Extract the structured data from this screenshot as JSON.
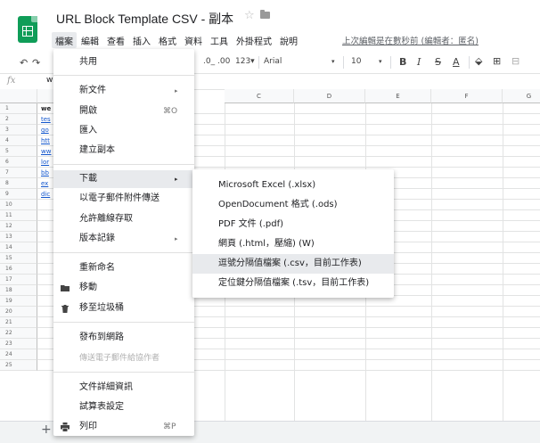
{
  "header": {
    "title": "URL Block Template CSV - 副本",
    "last_edit": "上次編輯是在數秒前 (編輯者：匿名)"
  },
  "menubar": [
    "檔案",
    "編輯",
    "查看",
    "插入",
    "格式",
    "資料",
    "工具",
    "外掛程式",
    "說明"
  ],
  "toolbar": {
    "decimal_decrease": ".0_",
    "decimal_increase": ".00",
    "format": "123▾",
    "font": "Arial",
    "font_dropdown": "▾",
    "font_size": "10",
    "size_dropdown": "▾",
    "bold": "B",
    "italic": "I",
    "strike": "S",
    "text_color": "A"
  },
  "formula_bar": {
    "fx": "fx",
    "cell_ref": "w"
  },
  "columns": [
    "C",
    "D",
    "E",
    "F",
    "G"
  ],
  "rows": [
    "1",
    "2",
    "3",
    "4",
    "5",
    "6",
    "7",
    "8",
    "9",
    "10",
    "11",
    "12",
    "13",
    "14",
    "15",
    "16",
    "17",
    "18",
    "19",
    "20",
    "21",
    "22",
    "23",
    "24",
    "25"
  ],
  "column_a_visible": [
    "we",
    "tes",
    "go",
    "htt",
    "ww",
    "lor",
    "bb",
    "ex",
    "dic"
  ],
  "file_menu": {
    "share": "共用",
    "new": "新文件",
    "open": "開啟",
    "open_shortcut": "⌘O",
    "import": "匯入",
    "make_copy": "建立副本",
    "download": "下載",
    "email_attachment": "以電子郵件附件傳送",
    "offline": "允許離線存取",
    "version_history": "版本記錄",
    "rename": "重新命名",
    "move": "移動",
    "trash": "移至垃圾桶",
    "publish": "發布到網路",
    "email_collaborators": "傳送電子郵件給協作者",
    "doc_details": "文件詳細資訊",
    "settings": "試算表設定",
    "print": "列印",
    "print_shortcut": "⌘P",
    "arrow": "▸"
  },
  "download_submenu": [
    "Microsoft Excel (.xlsx)",
    "OpenDocument 格式 (.ods)",
    "PDF 文件 (.pdf)",
    "網頁 (.html，壓縮) (W)",
    "逗號分隔值檔案 (.csv，目前工作表)",
    "定位鍵分隔值檔案 (.tsv，目前工作表)"
  ],
  "tabbar": {
    "add": "+"
  },
  "colors": {
    "brand_green": "#0f9d58",
    "link": "#1155cc",
    "highlight": "#e8eaed"
  }
}
